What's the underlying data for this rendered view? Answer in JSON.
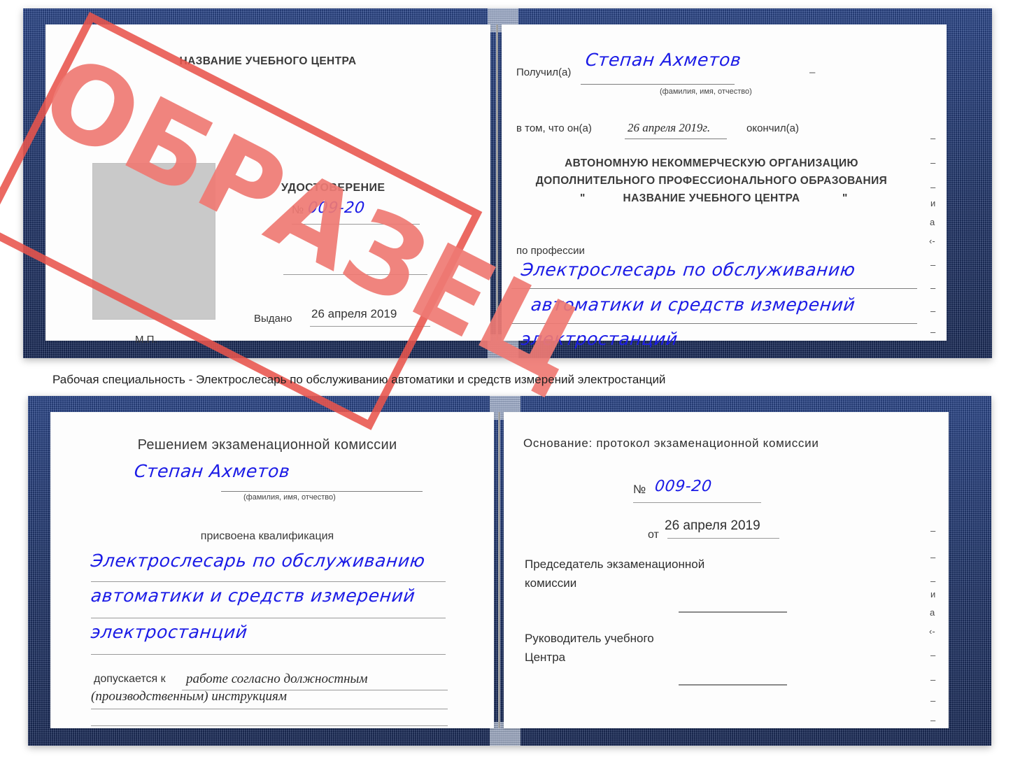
{
  "caption": "Рабочая специальность - Электрослесарь по обслуживанию автоматики и средств измерений электростанций",
  "stamp": {
    "text": "ОБРАЗЕЦ",
    "color": "#e8544c"
  },
  "colors": {
    "cover": "#27407f",
    "handwriting": "#1b1be6",
    "stamp": "#e8544c",
    "photo_placeholder": "#c9c9c9"
  },
  "top_spread": {
    "left_page": {
      "heading": "НАЗВАНИЕ УЧЕБНОГО ЦЕНТРА",
      "doc_type": "УДОСТОВЕРЕНИЕ",
      "number_label": "№",
      "number_value": "009-20",
      "issued_label": "Выдано",
      "issued_value": "26 апреля 2019",
      "seal_label": "М.П."
    },
    "right_page": {
      "received_label": "Получил(а)",
      "received_value": "Степан Ахметов",
      "name_hint": "(фамилия, имя, отчество)",
      "in_that_label": "в том, что он(а)",
      "in_that_date": "26 апреля 2019г.",
      "finished_label": "окончил(а)",
      "org_line1": "АВТОНОМНУЮ НЕКОММЕРЧЕСКУЮ ОРГАНИЗАЦИЮ",
      "org_line2": "ДОПОЛНИТЕЛЬНОГО ПРОФЕССИОНАЛЬНОГО ОБРАЗОВАНИЯ",
      "org_quote_open": "\"",
      "org_line3": "НАЗВАНИЕ УЧЕБНОГО ЦЕНТРА",
      "org_quote_close": "\"",
      "profession_label": "по профессии",
      "profession_line1": "Электрослесарь по обслуживанию",
      "profession_line2": "автоматики и средств измерений",
      "profession_line3": "электростанций",
      "edge_marks": [
        "–",
        "–",
        "–",
        "и",
        "а",
        "‹-",
        "–",
        "–",
        "–",
        "–"
      ]
    }
  },
  "bottom_spread": {
    "left_page": {
      "heading": "Решением экзаменационной комиссии",
      "name_value": "Степан Ахметов",
      "name_hint": "(фамилия, имя, отчество)",
      "qualification_label": "присвоена квалификация",
      "qualification_line1": "Электрослесарь по обслуживанию",
      "qualification_line2": "автоматики и средств измерений",
      "qualification_line3": "электростанций",
      "allowed_label": "допускается к",
      "allowed_value_line1": "работе согласно должностным",
      "allowed_value_line2": "(производственным) инструкциям"
    },
    "right_page": {
      "basis_label": "Основание: протокол экзаменационной комиссии",
      "number_label": "№",
      "number_value": "009-20",
      "date_label": "от",
      "date_value": "26 апреля 2019",
      "chairman_line1": "Председатель экзаменационной",
      "chairman_line2": "комиссии",
      "head_line1": "Руководитель учебного",
      "head_line2": "Центра",
      "edge_marks": [
        "–",
        "–",
        "–",
        "и",
        "а",
        "‹-",
        "–",
        "–",
        "–",
        "–"
      ]
    }
  }
}
